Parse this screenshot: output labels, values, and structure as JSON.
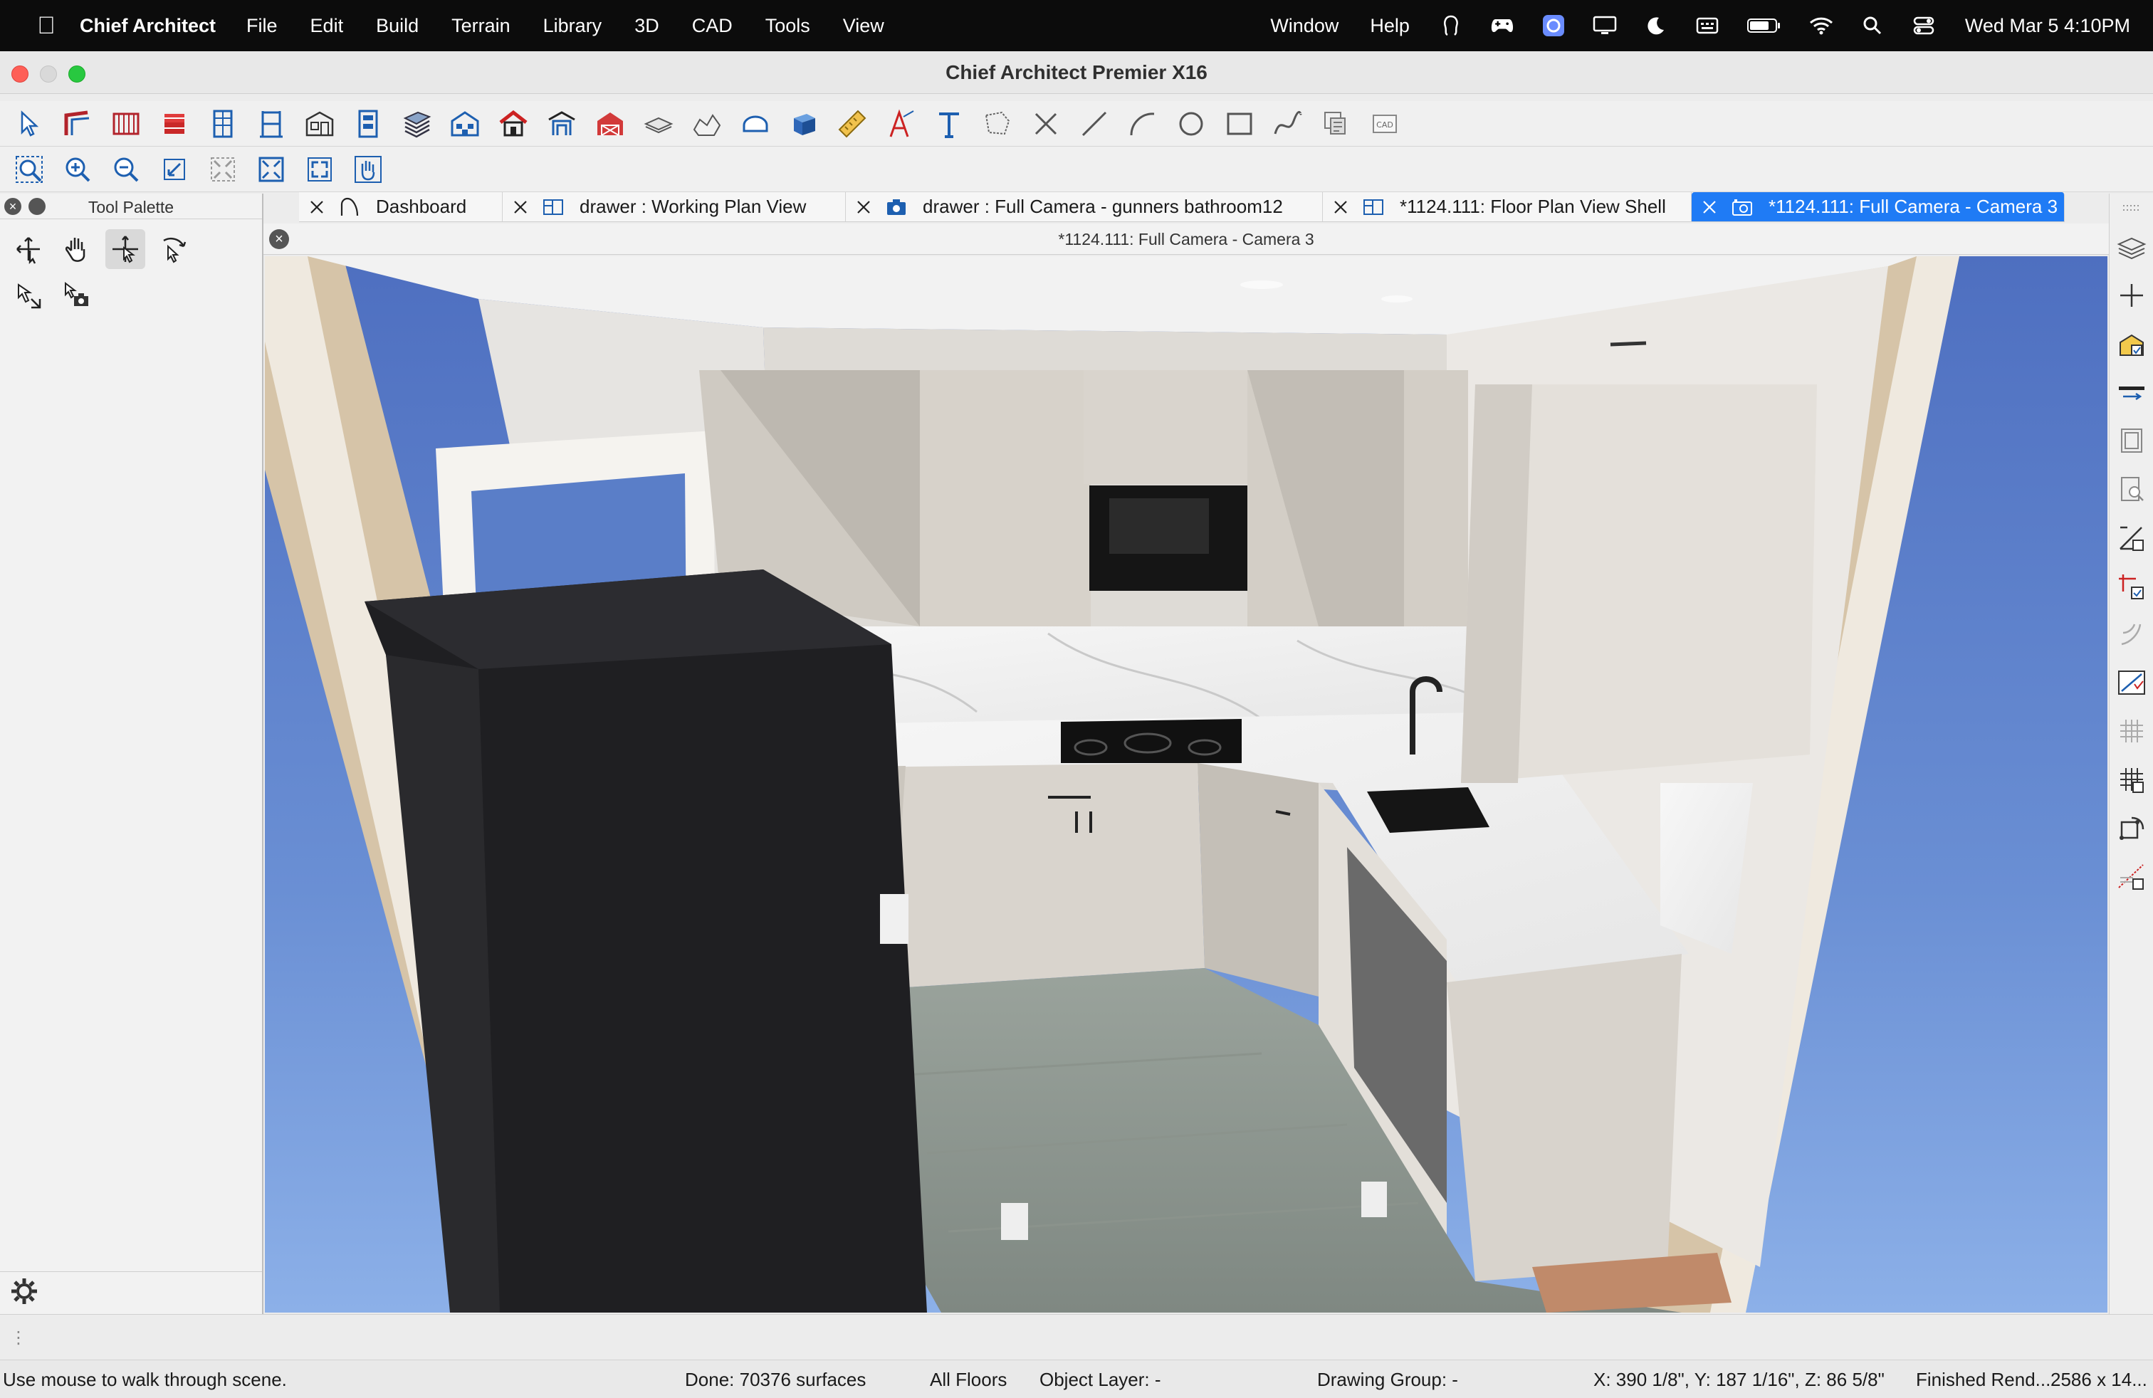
{
  "menubar": {
    "app_name": "Chief Architect",
    "items": [
      "File",
      "Edit",
      "Build",
      "Terrain",
      "Library",
      "3D",
      "CAD",
      "Tools",
      "View"
    ],
    "right_items": [
      "Window",
      "Help"
    ],
    "clock": "Wed Mar 5  4:10PM",
    "tray_icons": [
      "handoff-icon",
      "gamecontroller-icon",
      "app-badge-icon",
      "display-icon",
      "moon-icon",
      "keyboard-icon",
      "battery-icon",
      "wifi-icon",
      "search-icon",
      "control-center-icon"
    ]
  },
  "window": {
    "title": "Chief Architect Premier X16"
  },
  "toolbar1": {
    "icons": [
      "select-objects-icon",
      "wall-tools-icon",
      "cabinet-tools-icon",
      "stairs-icon",
      "window-icon",
      "door-icon",
      "fixture-icon",
      "shelf-icon",
      "roof-tools-icon",
      "building-icon",
      "house-icon",
      "entry-icon",
      "barn-icon",
      "floor-layer-icon",
      "terrain-icon",
      "arch-icon",
      "box-3d-icon",
      "ruler-icon",
      "text-arrow-icon",
      "text-icon",
      "polyline-icon",
      "cross-icon",
      "line-icon",
      "arc-icon",
      "circle-icon",
      "rectangle-icon",
      "spline-icon",
      "layer-set-icon",
      "cad-block-icon"
    ]
  },
  "toolbar2": {
    "icons": [
      "zoom-icon",
      "zoom-in-icon",
      "zoom-out-icon",
      "undo-zoom-icon",
      "fill-window-icon",
      "fill-window-all-icon",
      "fullscreen-icon",
      "pan-hand-icon"
    ]
  },
  "palette": {
    "title": "Tool Palette",
    "tools": [
      "walkthrough-icon",
      "hand-icon",
      "move-camera-icon",
      "tilt-camera-icon",
      "arrow-camera-icon",
      "camera-select-icon"
    ],
    "active_index": 2
  },
  "tabs": [
    {
      "label": "Dashboard",
      "icon": "dashboard-icon"
    },
    {
      "label": "drawer :  Working Plan View",
      "icon": "plan-view-icon"
    },
    {
      "label": "drawer : Full Camera - gunners bathroom12",
      "icon": "camera-icon"
    },
    {
      "label": "*1124.111: Floor Plan View Shell",
      "icon": "plan-view-icon"
    },
    {
      "label": "*1124.111: Full Camera - Camera 3",
      "icon": "camera-icon",
      "active": true
    }
  ],
  "view": {
    "title": "*1124.111: Full Camera - Camera 3"
  },
  "right_tools": [
    "layer-stack-icon",
    "crosshair-icon",
    "object-edit-icon",
    "wall-section-icon",
    "door-panel-icon",
    "window-search-icon",
    "edit-angle-icon",
    "edit-cross-icon",
    "arc-edit-icon",
    "break-edit-icon",
    "grid-icon",
    "grid-check-icon",
    "rotate-object-icon",
    "terrain-edit-icon"
  ],
  "status": {
    "message": "Use mouse to walk through scene.",
    "done": "Done:  70376 surfaces",
    "floors": "All Floors",
    "object_layer": "Object Layer: -",
    "drawing_group": "Drawing Group: -",
    "coords": "X: 390 1/8\", Y: 187 1/16\", Z: 86 5/8\"",
    "render": "Finished Rend...",
    "size": "2586 x 14..."
  },
  "colors": {
    "accent": "#1f7bf5",
    "sky": "#5a7ec8",
    "fridge": "#2a2a2d",
    "cabinet": "#d9d4cd"
  }
}
